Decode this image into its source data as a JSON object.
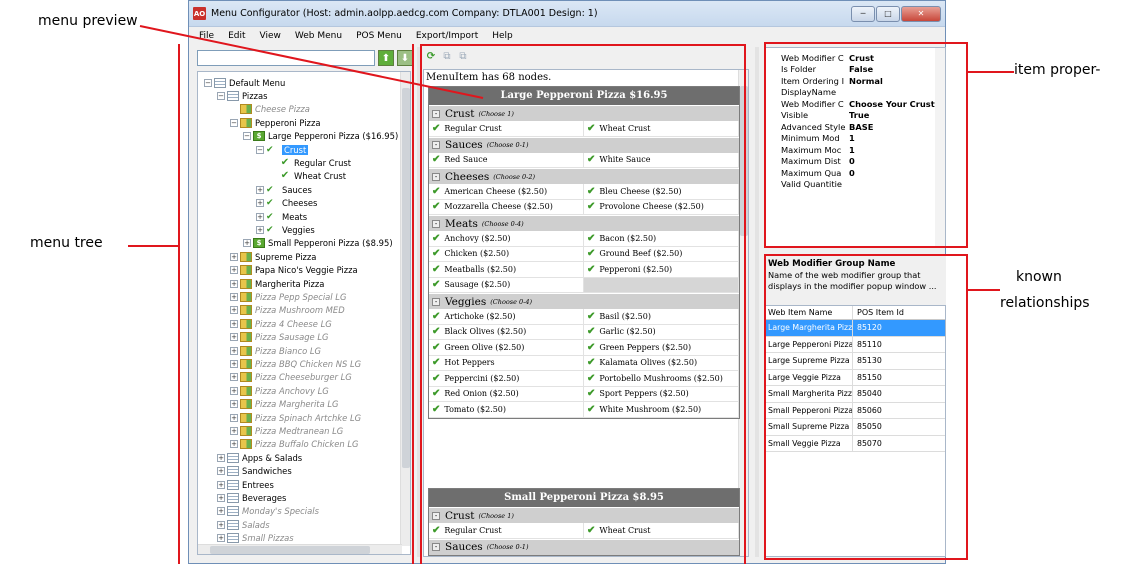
{
  "annotations": {
    "menu_preview": "menu preview",
    "menu_tree": "menu tree",
    "item_properties": "item proper-",
    "known_relationships_1": "known",
    "known_relationships_2": "relationships"
  },
  "window": {
    "title": "Menu Configurator  (Host: admin.aolpp.aedcg.com   Company: DTLA001   Design: 1)",
    "app_icon_text": "AO",
    "buttons": {
      "minimize": "─",
      "maximize": "□",
      "close": "✕"
    }
  },
  "menubar": [
    "File",
    "Edit",
    "View",
    "Web Menu",
    "POS Menu",
    "Export/Import",
    "Help"
  ],
  "tree": {
    "search_value": "",
    "up_arrow": "⬆",
    "down_arrow": "⬇",
    "items": [
      {
        "label": "Default Menu",
        "icon": "menu-icon"
      },
      {
        "label": "Pizzas",
        "icon": "menu-icon"
      },
      {
        "label": "Cheese Pizza",
        "icon": "folder-icon",
        "dim": true
      },
      {
        "label": "Pepperoni Pizza",
        "icon": "folder-icon"
      },
      {
        "label": "Large Pepperoni Pizza ($16.95)",
        "icon": "dollar-icon"
      },
      {
        "label": "Crust",
        "icon": "checks-icon",
        "selected": true
      },
      {
        "label": "Regular Crust",
        "icon": "check-icon"
      },
      {
        "label": "Wheat Crust",
        "icon": "check-icon"
      },
      {
        "label": "Sauces",
        "icon": "checks-icon"
      },
      {
        "label": "Cheeses",
        "icon": "checks-icon"
      },
      {
        "label": "Meats",
        "icon": "checks-icon"
      },
      {
        "label": "Veggies",
        "icon": "checks-icon"
      },
      {
        "label": "Small Pepperoni Pizza ($8.95)",
        "icon": "dollar-icon"
      },
      {
        "label": "Supreme Pizza",
        "icon": "folder-icon"
      },
      {
        "label": "Papa Nico's Veggie Pizza",
        "icon": "folder-icon"
      },
      {
        "label": "Margherita Pizza",
        "icon": "folder-icon"
      },
      {
        "label": "Pizza Pepp Special LG",
        "icon": "folder-icon",
        "dim": true
      },
      {
        "label": "Pizza Mushroom MED",
        "icon": "folder-icon",
        "dim": true
      },
      {
        "label": "Pizza 4 Cheese LG",
        "icon": "folder-icon",
        "dim": true
      },
      {
        "label": "Pizza Sausage LG",
        "icon": "folder-icon",
        "dim": true
      },
      {
        "label": "Pizza Bianco LG",
        "icon": "folder-icon",
        "dim": true
      },
      {
        "label": "Pizza BBQ Chicken NS LG",
        "icon": "folder-icon",
        "dim": true
      },
      {
        "label": "Pizza Cheeseburger LG",
        "icon": "folder-icon",
        "dim": true
      },
      {
        "label": "Pizza Anchovy LG",
        "icon": "folder-icon",
        "dim": true
      },
      {
        "label": "Pizza Margherita LG",
        "icon": "folder-icon",
        "dim": true
      },
      {
        "label": "Pizza Spinach Artchke LG",
        "icon": "folder-icon",
        "dim": true
      },
      {
        "label": "Pizza Medtranean LG",
        "icon": "folder-icon",
        "dim": true
      },
      {
        "label": "Pizza Buffalo Chicken LG",
        "icon": "folder-icon",
        "dim": true
      },
      {
        "label": "Apps & Salads",
        "icon": "menu-icon"
      },
      {
        "label": "Sandwiches",
        "icon": "menu-icon"
      },
      {
        "label": "Entrees",
        "icon": "menu-icon"
      },
      {
        "label": "Beverages",
        "icon": "menu-icon"
      },
      {
        "label": "Monday's Specials",
        "icon": "menu-icon",
        "dim": true
      },
      {
        "label": "Salads",
        "icon": "menu-icon",
        "dim": true
      },
      {
        "label": "Small Pizzas",
        "icon": "menu-icon",
        "dim": true
      }
    ],
    "hscroll_label": "III"
  },
  "preview": {
    "info": "MenuItem has 68 nodes.",
    "cards": [
      {
        "title": "Large Pepperoni Pizza $16.95",
        "groups": [
          {
            "name": "Crust",
            "rule": "(Choose 1)",
            "options": [
              "Regular Crust",
              "Wheat Crust"
            ]
          },
          {
            "name": "Sauces",
            "rule": "(Choose 0-1)",
            "options": [
              "Red Sauce",
              "White Sauce"
            ]
          },
          {
            "name": "Cheeses",
            "rule": "(Choose 0-2)",
            "options": [
              "American Cheese ($2.50)",
              "Bleu Cheese ($2.50)",
              "Mozzarella Cheese ($2.50)",
              "Provolone Cheese ($2.50)"
            ]
          },
          {
            "name": "Meats",
            "rule": "(Choose 0-4)",
            "options": [
              "Anchovy ($2.50)",
              "Bacon ($2.50)",
              "Chicken ($2.50)",
              "Ground Beef ($2.50)",
              "Meatballs ($2.50)",
              "Pepperoni ($2.50)",
              "Sausage ($2.50)"
            ]
          },
          {
            "name": "Veggies",
            "rule": "(Choose 0-4)",
            "options": [
              "Artichoke ($2.50)",
              "Basil ($2.50)",
              "Black Olives ($2.50)",
              "Garlic ($2.50)",
              "Green Olive ($2.50)",
              "Green Peppers ($2.50)",
              "Hot Peppers",
              "Kalamata Olives ($2.50)",
              "Peppercini ($2.50)",
              "Portobello Mushrooms ($2.50)",
              "Red Onion ($2.50)",
              "Sport Peppers ($2.50)",
              "Tomato ($2.50)",
              "White Mushroom ($2.50)"
            ]
          }
        ]
      },
      {
        "title": "Small Pepperoni Pizza $8.95",
        "groups": [
          {
            "name": "Crust",
            "rule": "(Choose 1)",
            "options": [
              "Regular Crust",
              "Wheat Crust"
            ]
          },
          {
            "name": "Sauces",
            "rule": "(Choose 0-1)",
            "options": []
          }
        ]
      }
    ]
  },
  "properties": [
    {
      "key": "Web Modifier C",
      "value": "Crust"
    },
    {
      "key": "Is Folder",
      "value": "False"
    },
    {
      "key": "Item Ordering I",
      "value": "Normal"
    },
    {
      "key": "DisplayName",
      "value": ""
    },
    {
      "key": "Web Modifier C",
      "value": "Choose Your Crust"
    },
    {
      "key": "Visible",
      "value": "True"
    },
    {
      "key": "Advanced Style",
      "value": "BASE"
    },
    {
      "key": "Minimum Mod",
      "value": "1"
    },
    {
      "key": "Maximum Moc",
      "value": "1"
    },
    {
      "key": "Maximum Dist",
      "value": "0"
    },
    {
      "key": "Maximum Qua",
      "value": "0"
    },
    {
      "key": "Valid Quantitie",
      "value": ""
    }
  ],
  "description": {
    "title": "Web Modifier Group Name",
    "text": "Name of the web modifier group that displays in the modifier popup window ..."
  },
  "relationships": {
    "headers": [
      "Web Item Name",
      "POS Item Id"
    ],
    "rows": [
      [
        "Large Margherita Pizza",
        "85120"
      ],
      [
        "Large Pepperoni Pizza",
        "85110"
      ],
      [
        "Large Supreme Pizza",
        "85130"
      ],
      [
        "Large Veggie Pizza",
        "85150"
      ],
      [
        "Small Margherita Pizza",
        "85040"
      ],
      [
        "Small Pepperoni Pizza",
        "85060"
      ],
      [
        "Small Supreme Pizza",
        "85050"
      ],
      [
        "Small Veggie Pizza",
        "85070"
      ]
    ],
    "selected_index": 0
  }
}
